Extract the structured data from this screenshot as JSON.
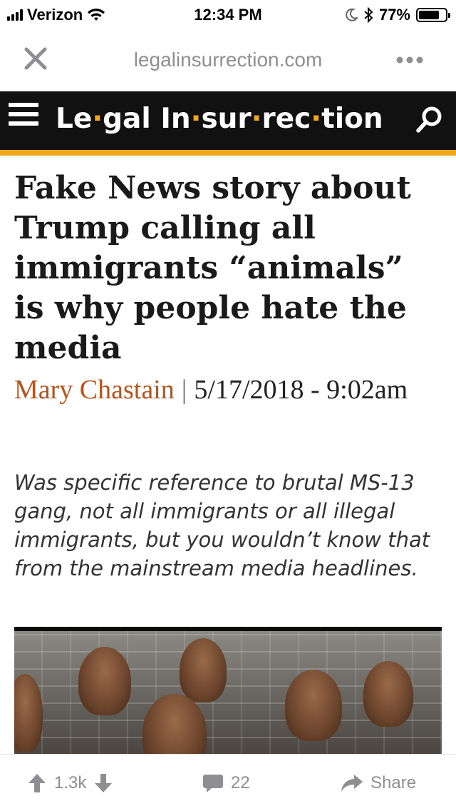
{
  "status_bar": {
    "carrier": "Verizon",
    "time": "12:34 PM",
    "battery_percent": "77%",
    "battery_level": 0.77
  },
  "browser": {
    "url": "legalinsurrection.com",
    "close_icon": "close-icon",
    "more_icon": "more-icon"
  },
  "site": {
    "brand_parts": [
      "Le",
      "gal",
      "In",
      "sur",
      "rec",
      "tion"
    ],
    "accent_color": "#f2a81d",
    "header_color": "#111111"
  },
  "article": {
    "headline": "Fake News story about Trump calling all immigrants “animals” is why people hate the media",
    "author": "Mary Chastain",
    "date": "5/17/2018 - 9:02am",
    "dek": "Was specific reference to brutal MS-13 gang, not all immigrants or all illegal immigrants, but you wouldn’t know that from the mainstream media headlines."
  },
  "toolbar": {
    "votes": "1.3k",
    "comments": "22",
    "share_label": "Share"
  }
}
